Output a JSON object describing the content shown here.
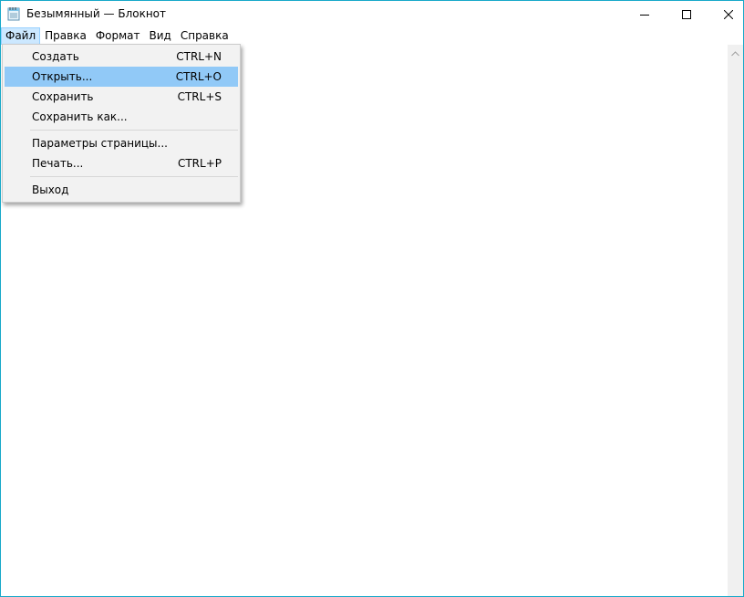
{
  "window": {
    "title": "Безымянный — Блокнот",
    "accent_border": "#18a9c9"
  },
  "title_buttons": {
    "minimize": "minimize-icon",
    "maximize": "maximize-icon",
    "close": "close-icon"
  },
  "menubar": {
    "items": [
      {
        "label": "Файл",
        "active": true
      },
      {
        "label": "Правка",
        "active": false
      },
      {
        "label": "Формат",
        "active": false
      },
      {
        "label": "Вид",
        "active": false
      },
      {
        "label": "Справка",
        "active": false
      }
    ],
    "active_bg": "#cce8ff"
  },
  "file_menu": {
    "highlight_color": "#91c9f7",
    "items": [
      {
        "label": "Создать",
        "shortcut": "CTRL+N",
        "highlighted": false
      },
      {
        "label": "Открыть...",
        "shortcut": "CTRL+O",
        "highlighted": true
      },
      {
        "label": "Сохранить",
        "shortcut": "CTRL+S",
        "highlighted": false
      },
      {
        "label": "Сохранить как...",
        "shortcut": "",
        "highlighted": false
      },
      {
        "label": "Параметры страницы...",
        "shortcut": "",
        "highlighted": false
      },
      {
        "label": "Печать...",
        "shortcut": "CTRL+P",
        "highlighted": false
      },
      {
        "label": "Выход",
        "shortcut": "",
        "highlighted": false
      }
    ]
  },
  "editor": {
    "content": ""
  }
}
